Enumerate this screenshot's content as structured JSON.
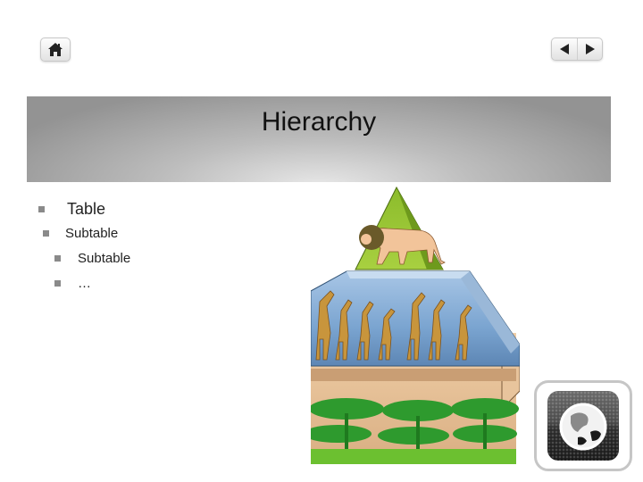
{
  "nav": {
    "home_icon": "home-icon",
    "prev_icon": "triangle-left-icon",
    "next_icon": "triangle-right-icon"
  },
  "slide": {
    "title": "Hierarchy",
    "bullets": [
      {
        "level": 1,
        "text": "Table"
      },
      {
        "level": 1,
        "text": "Subtable"
      },
      {
        "level": 2,
        "text": "Subtable"
      },
      {
        "level": 2,
        "text": "…"
      }
    ]
  },
  "illustration": {
    "subject": "food-chain-pyramid",
    "tiers": [
      "lion",
      "giraffes",
      "acacia-trees"
    ]
  },
  "corner_icon": "globe-icon"
}
